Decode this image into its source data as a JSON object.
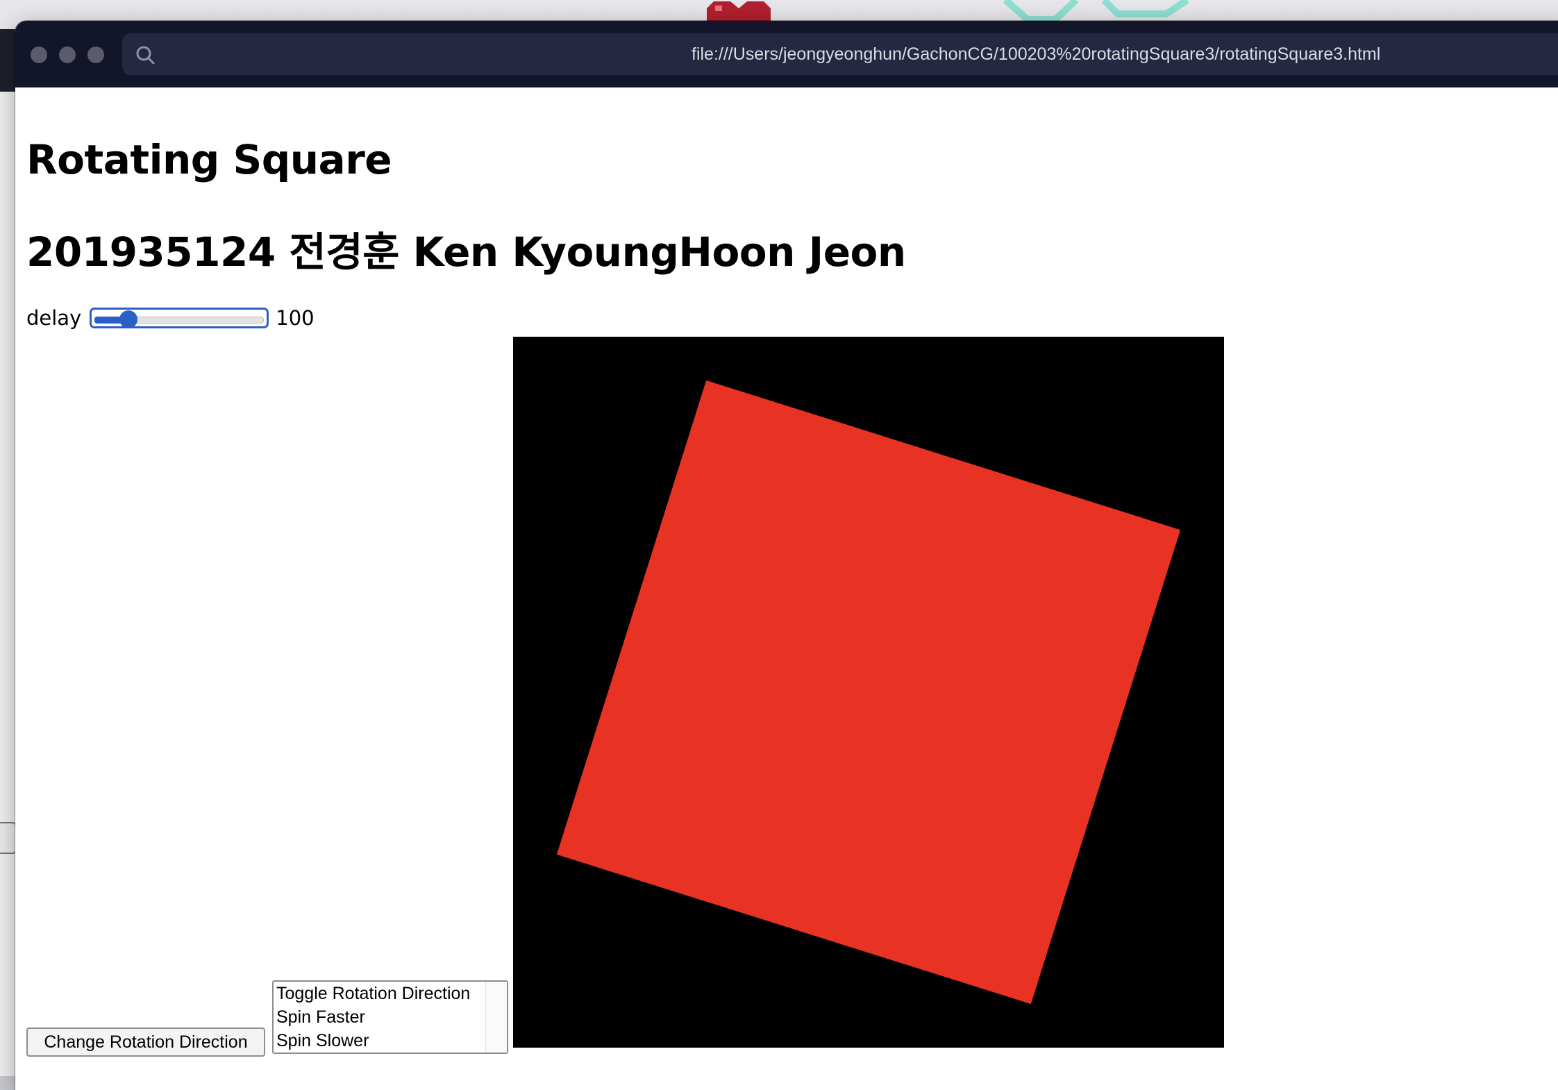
{
  "browser": {
    "url": "file:///Users/jeongyeonghun/GachonCG/100203%20rotatingSquare3/rotatingSquare3.html"
  },
  "page": {
    "title": "Rotating Square",
    "subtitle": "201935124 전경훈 Ken KyoungHoon Jeon"
  },
  "controls": {
    "delay_label": "delay",
    "delay_value": "100",
    "delay_slider_fraction": 0.2,
    "change_direction_label": "Change Rotation Direction",
    "menu_options": [
      "Toggle Rotation Direction",
      "Spin Faster",
      "Spin Slower"
    ]
  },
  "scene": {
    "background_color": "#000000",
    "square_color": "#e83324",
    "rotation_degrees": 17.5
  },
  "icons": {
    "address_search": "search-icon",
    "window_controls": "traffic-light-icons"
  }
}
